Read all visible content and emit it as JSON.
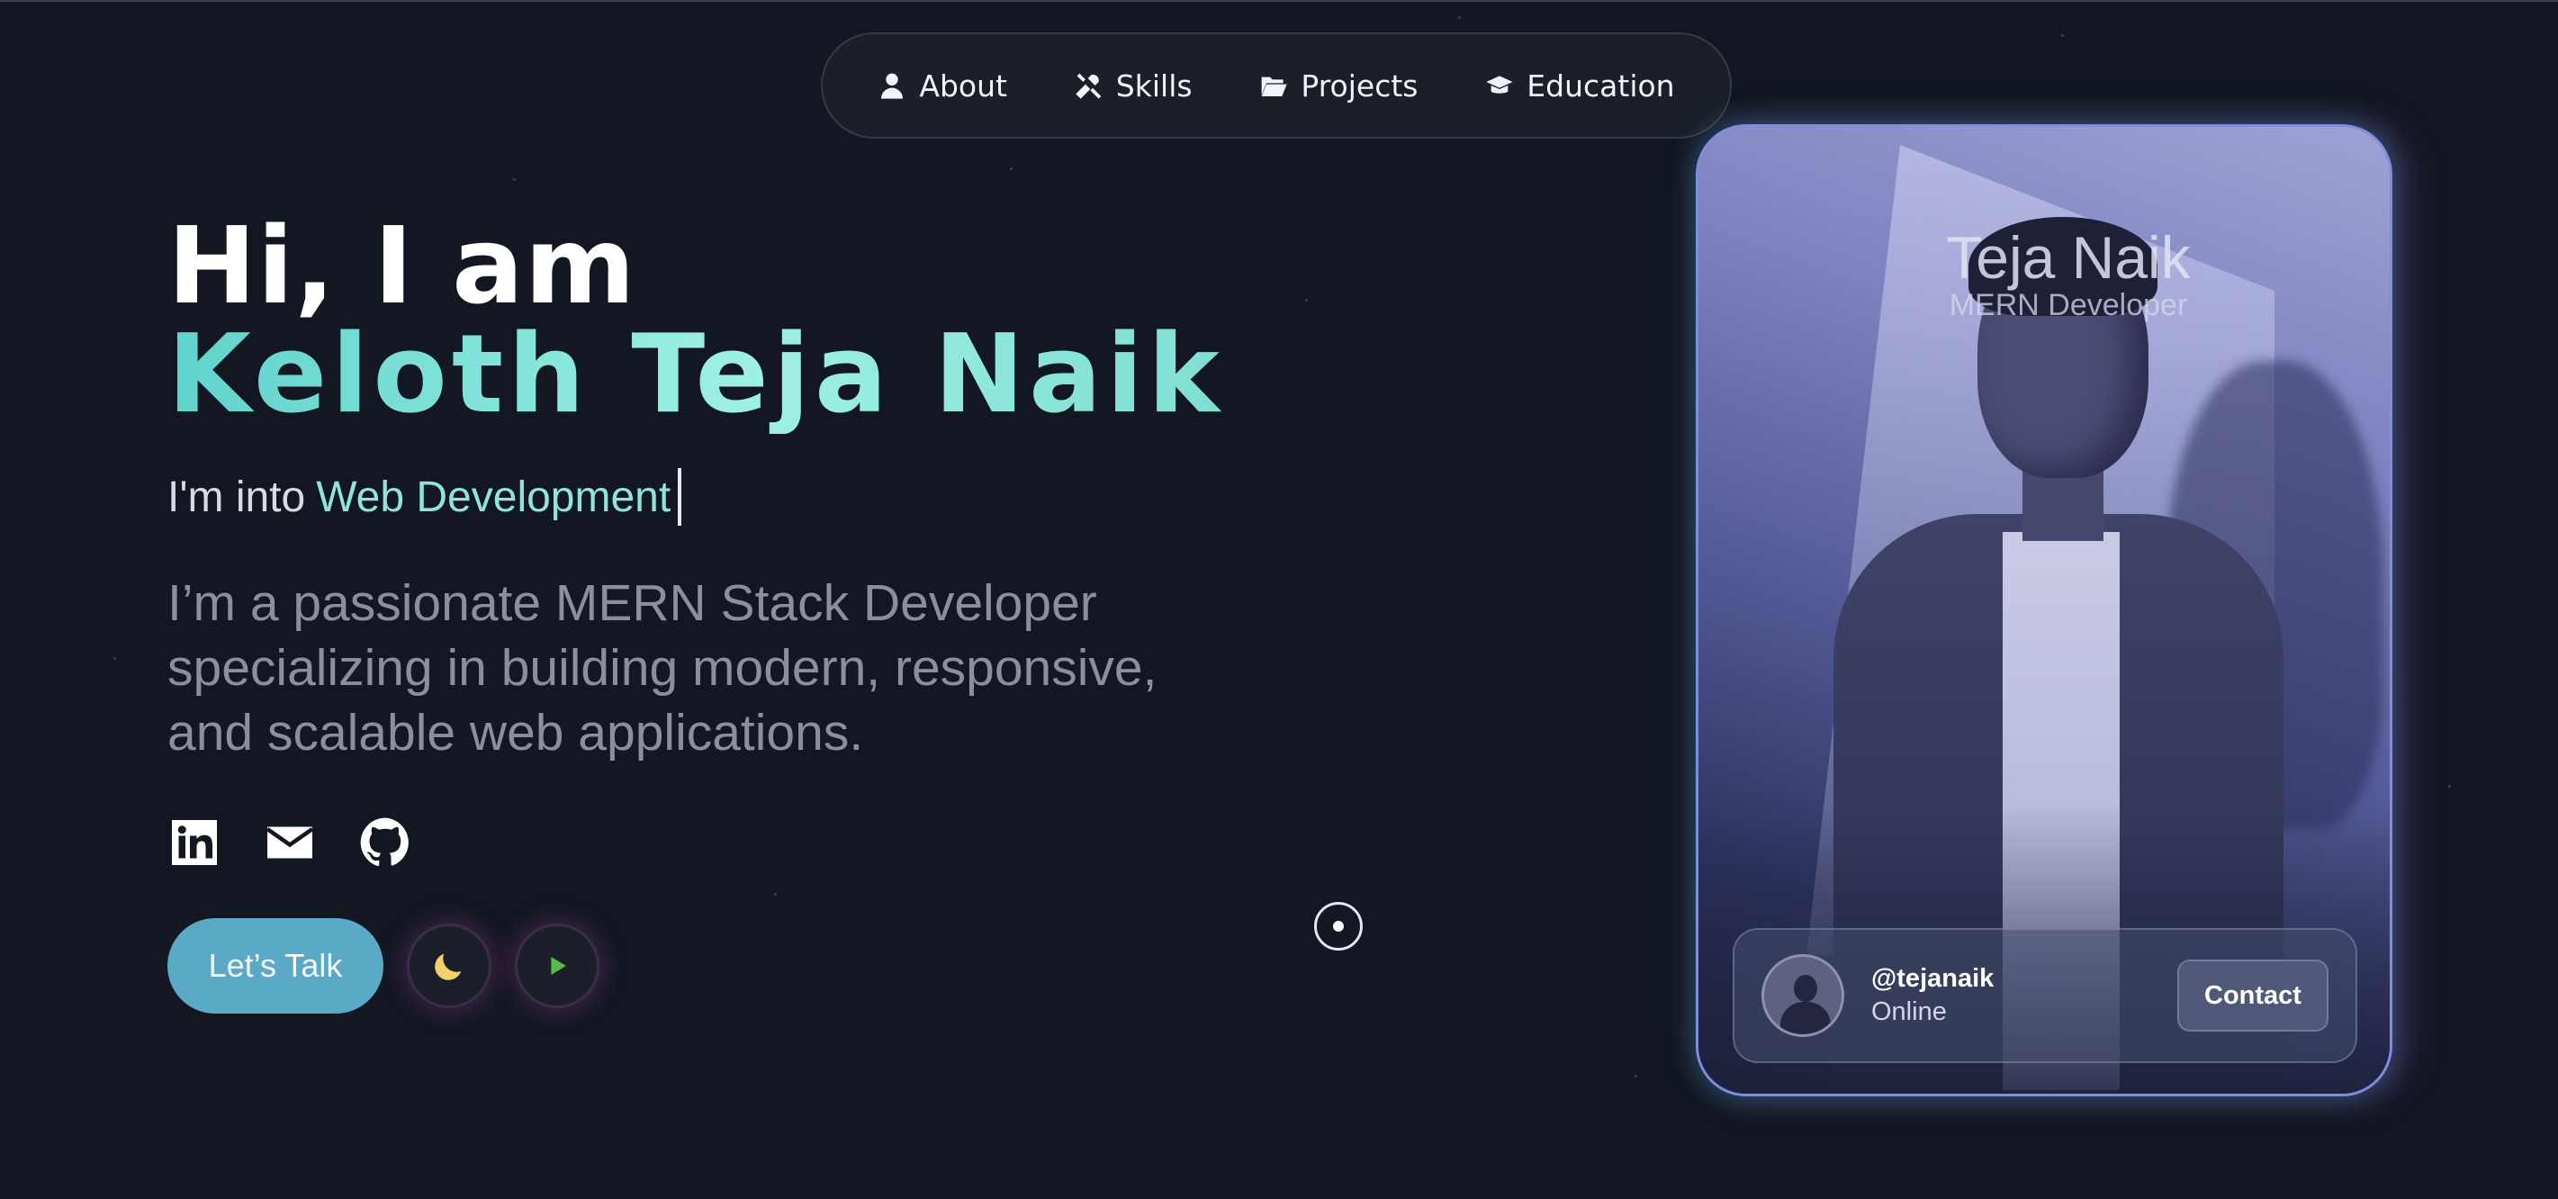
{
  "nav": {
    "items": [
      {
        "label": "About",
        "icon": "user-icon"
      },
      {
        "label": "Skills",
        "icon": "tools-icon"
      },
      {
        "label": "Projects",
        "icon": "folder-open-icon"
      },
      {
        "label": "Education",
        "icon": "graduation-cap-icon"
      }
    ]
  },
  "hero": {
    "greeting": "Hi, I am",
    "name": "Keloth Teja Naik",
    "into_prefix": "I'm into",
    "into_highlight": "Web Development",
    "bio": "I’m a passionate MERN Stack Developer specializing in building modern, responsive, and scalable web applications.",
    "socials": [
      "linkedin-icon",
      "mail-icon",
      "github-icon"
    ],
    "cta_label": "Let’s Talk"
  },
  "controls": {
    "theme_icon": "moon-icon",
    "play_icon": "play-icon"
  },
  "card": {
    "name": "Teja Naik",
    "role": "MERN Developer",
    "handle": "@tejanaik",
    "status": "Online",
    "contact_label": "Contact"
  },
  "colors": {
    "background": "#121722",
    "accent_teal": "#86e6dc",
    "button_blue": "#5aa9c6",
    "moon_yellow": "#f2d36b",
    "play_green": "#58b94e"
  }
}
